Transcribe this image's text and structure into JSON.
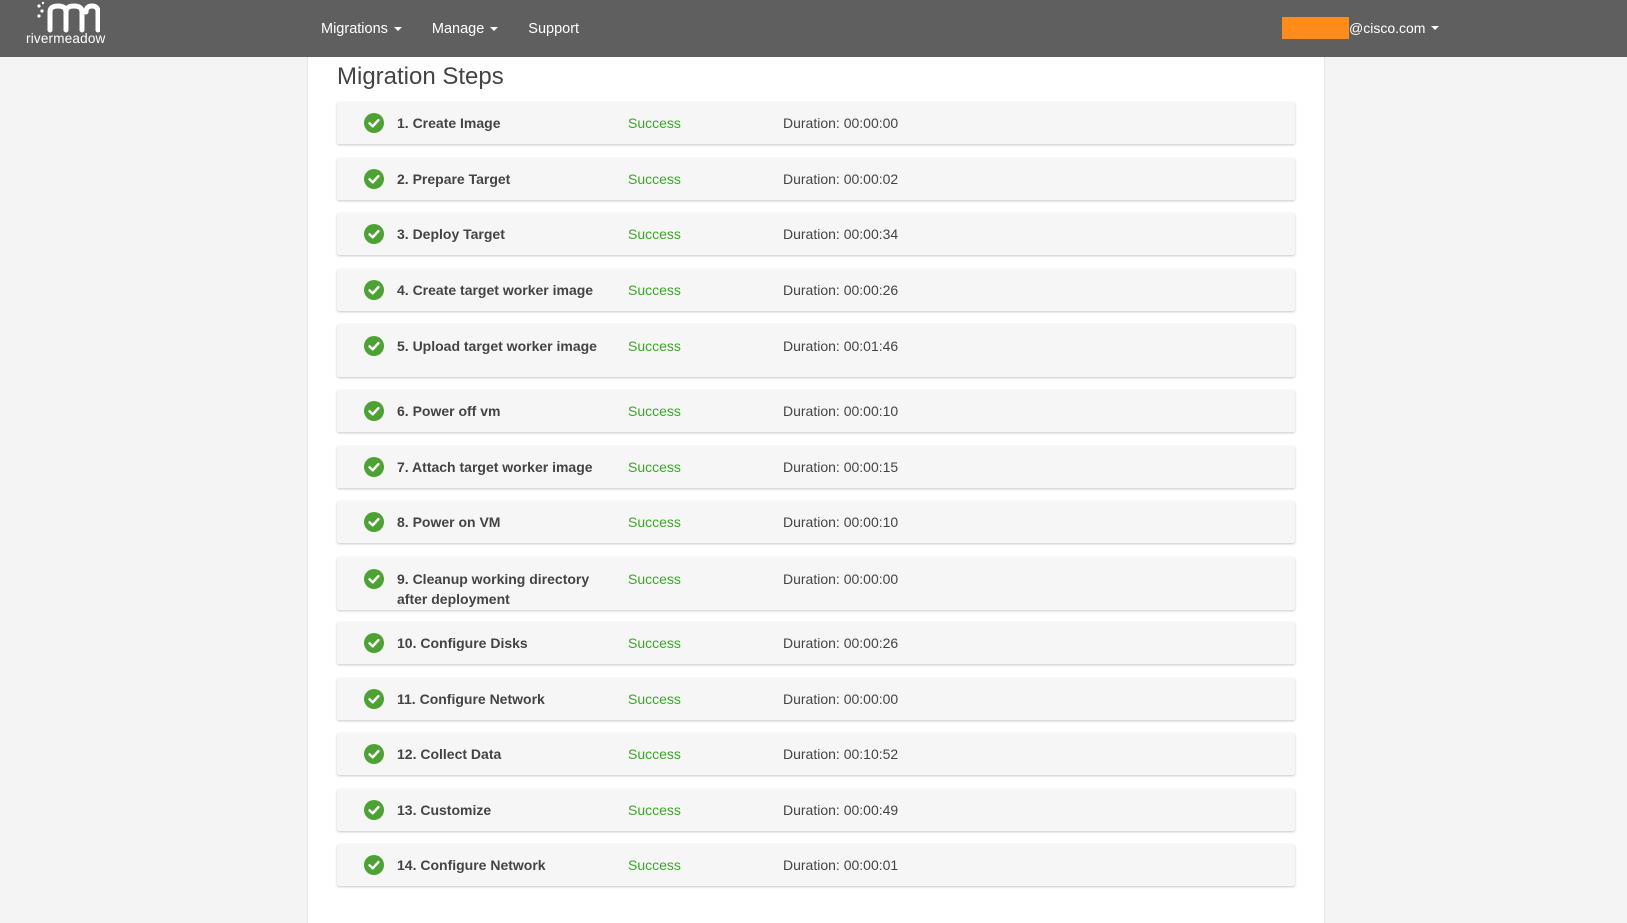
{
  "brand": {
    "logo_text": "rivermeadow"
  },
  "nav": {
    "items": [
      {
        "label": "Migrations",
        "dropdown": true
      },
      {
        "label": "Manage",
        "dropdown": true
      },
      {
        "label": "Support",
        "dropdown": false
      }
    ],
    "user_label": "@cisco.com"
  },
  "colors": {
    "navbar": "#5f5f5f",
    "success": "#3aa827",
    "check": "#4da233",
    "redaction": "#ff8c1a"
  },
  "page": {
    "title": "Migration Steps"
  },
  "steps": [
    {
      "name": "1. Create Image",
      "status": "Success",
      "duration": "Duration: 00:00:00",
      "icon": "check-circle-icon"
    },
    {
      "name": "2. Prepare Target",
      "status": "Success",
      "duration": "Duration: 00:00:02",
      "icon": "check-circle-icon"
    },
    {
      "name": "3. Deploy Target",
      "status": "Success",
      "duration": "Duration: 00:00:34",
      "icon": "check-circle-icon"
    },
    {
      "name": "4. Create target worker image",
      "status": "Success",
      "duration": "Duration: 00:00:26",
      "icon": "check-circle-icon"
    },
    {
      "name": "5. Upload target worker image",
      "status": "Success",
      "duration": "Duration: 00:01:46",
      "icon": "check-circle-icon"
    },
    {
      "name": "6. Power off vm",
      "status": "Success",
      "duration": "Duration: 00:00:10",
      "icon": "check-circle-icon"
    },
    {
      "name": "7. Attach target worker image",
      "status": "Success",
      "duration": "Duration: 00:00:15",
      "icon": "check-circle-icon"
    },
    {
      "name": "8. Power on VM",
      "status": "Success",
      "duration": "Duration: 00:00:10",
      "icon": "check-circle-icon"
    },
    {
      "name": "9. Cleanup working directory after deployment",
      "status": "Success",
      "duration": "Duration: 00:00:00",
      "icon": "check-circle-icon"
    },
    {
      "name": "10. Configure Disks",
      "status": "Success",
      "duration": "Duration: 00:00:26",
      "icon": "check-circle-icon"
    },
    {
      "name": "11. Configure Network",
      "status": "Success",
      "duration": "Duration: 00:00:00",
      "icon": "check-circle-icon"
    },
    {
      "name": "12. Collect Data",
      "status": "Success",
      "duration": "Duration: 00:10:52",
      "icon": "check-circle-icon"
    },
    {
      "name": "13. Customize",
      "status": "Success",
      "duration": "Duration: 00:00:49",
      "icon": "check-circle-icon"
    },
    {
      "name": "14. Configure Network",
      "status": "Success",
      "duration": "Duration: 00:00:01",
      "icon": "check-circle-icon"
    }
  ]
}
